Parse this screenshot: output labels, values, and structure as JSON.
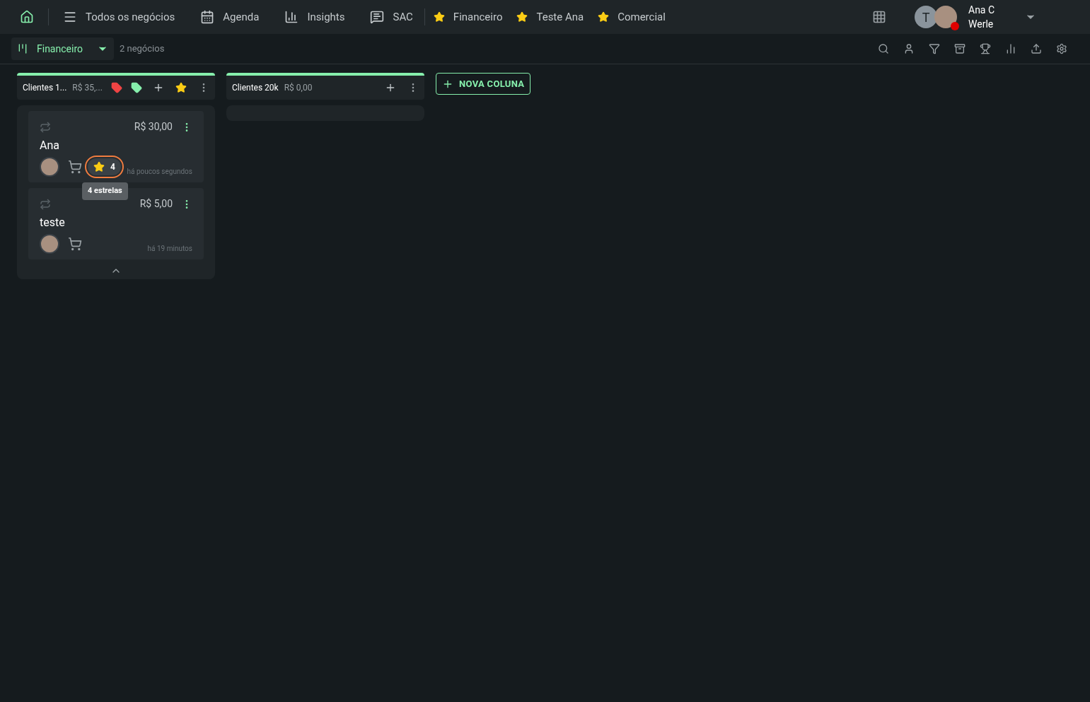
{
  "nav": {
    "items": [
      {
        "label": "Todos os negócios"
      },
      {
        "label": "Agenda"
      },
      {
        "label": "Insights"
      },
      {
        "label": "SAC"
      }
    ],
    "favorites": [
      {
        "label": "Financeiro"
      },
      {
        "label": "Teste Ana"
      },
      {
        "label": "Comercial"
      }
    ],
    "user": {
      "initial": "T",
      "name_line_1": "Ana C",
      "name_line_2": "Werle"
    }
  },
  "toolbar": {
    "pipeline": "Financeiro",
    "count": "2 negócios"
  },
  "columns": [
    {
      "title": "Clientes 1...",
      "total": "R$ 35,...",
      "tags": [
        {
          "color": "#ef4444"
        },
        {
          "color": "#86efac"
        }
      ],
      "starred": true,
      "cards": [
        {
          "value": "R$ 30,00",
          "name": "Ana",
          "rating": "4",
          "rating_highlighted": true,
          "tooltip": "4 estrelas",
          "time": "há poucos segundos"
        },
        {
          "value": "R$ 5,00",
          "name": "teste",
          "time": "há 19 minutos"
        }
      ]
    },
    {
      "title": "Clientes 20k",
      "total": "R$ 0,00",
      "starred": false
    }
  ],
  "new_column": "NOVA COLUNA"
}
